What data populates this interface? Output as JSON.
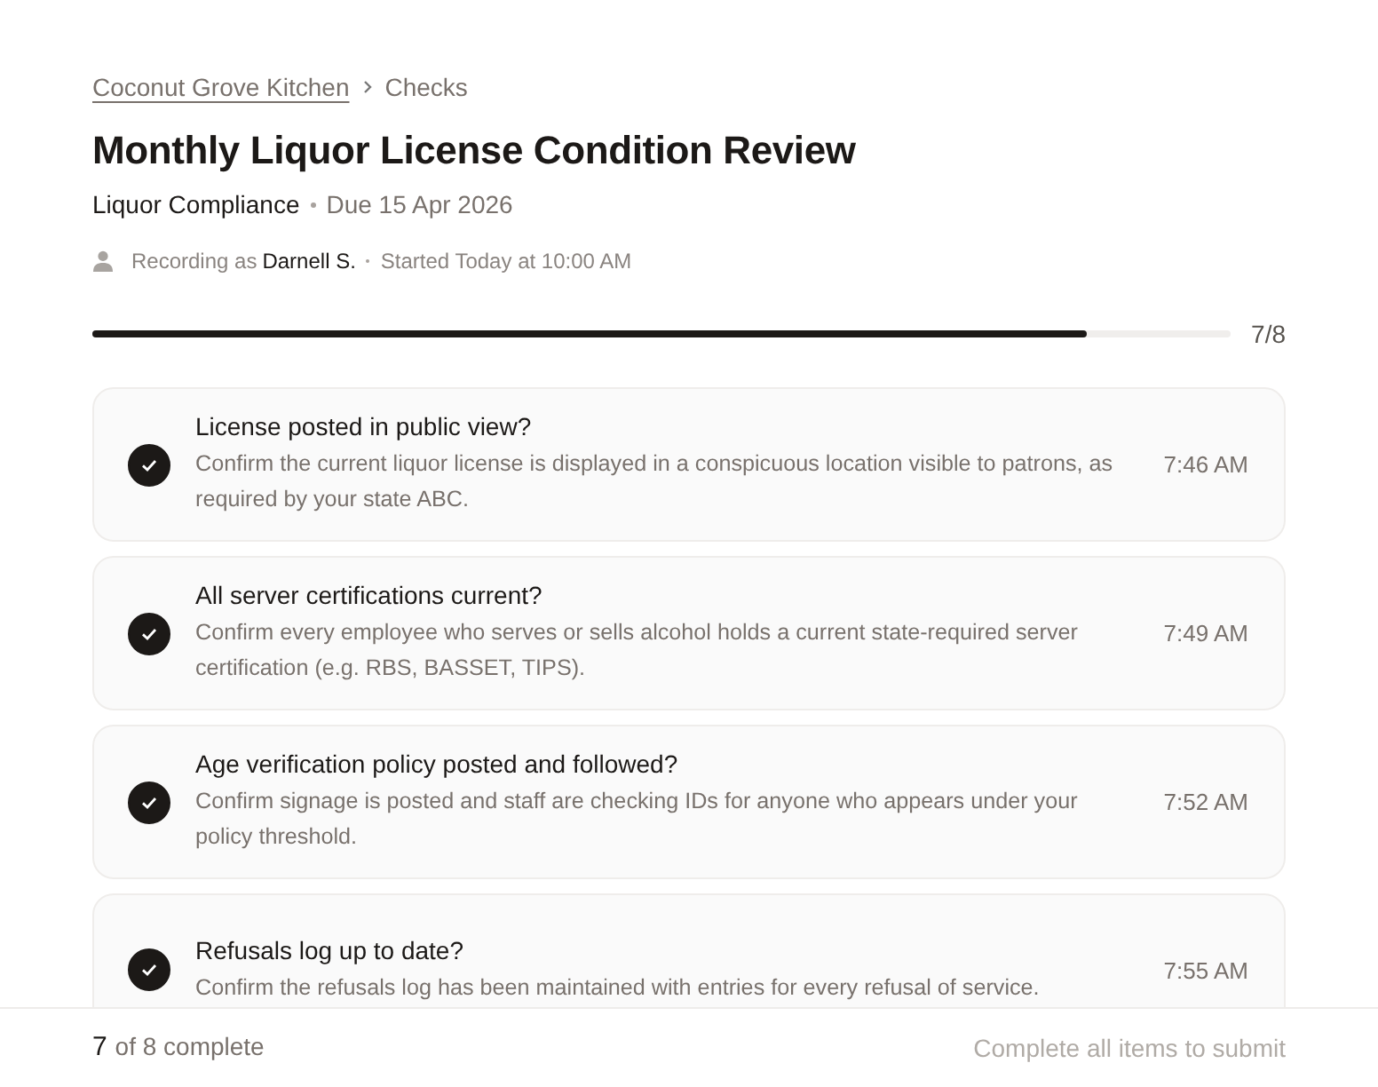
{
  "breadcrumb": {
    "parent": "Coconut Grove Kitchen",
    "current": "Checks"
  },
  "title": "Monthly Liquor License Condition Review",
  "category": "Liquor Compliance",
  "due": "Due 15 Apr 2026",
  "meta": {
    "recording_label": "Recording as",
    "user": "Darnell S.",
    "started": "Started Today at 10:00 AM"
  },
  "progress": {
    "level": 0.875,
    "reading": "7/8"
  },
  "items": [
    {
      "title": "License posted in public view?",
      "description": "Confirm the current liquor license is displayed in a conspicuous location visible to patrons, as required by your state ABC.",
      "time": "7:46 AM",
      "checked": true
    },
    {
      "title": "All server certifications current?",
      "description": "Confirm every employee who serves or sells alcohol holds a current state-required server certification (e.g. RBS, BASSET, TIPS).",
      "time": "7:49 AM",
      "checked": true
    },
    {
      "title": "Age verification policy posted and followed?",
      "description": "Confirm signage is posted and staff are checking IDs for anyone who appears under your policy threshold.",
      "time": "7:52 AM",
      "checked": true
    },
    {
      "title": "Refusals log up to date?",
      "description": "Confirm the refusals log has been maintained with entries for every refusal of service.",
      "time": "7:55 AM",
      "checked": true
    }
  ],
  "footer": {
    "done": "7",
    "label": "of 8 complete",
    "submit": {
      "label": "Complete all items to submit",
      "disabled": true
    }
  }
}
